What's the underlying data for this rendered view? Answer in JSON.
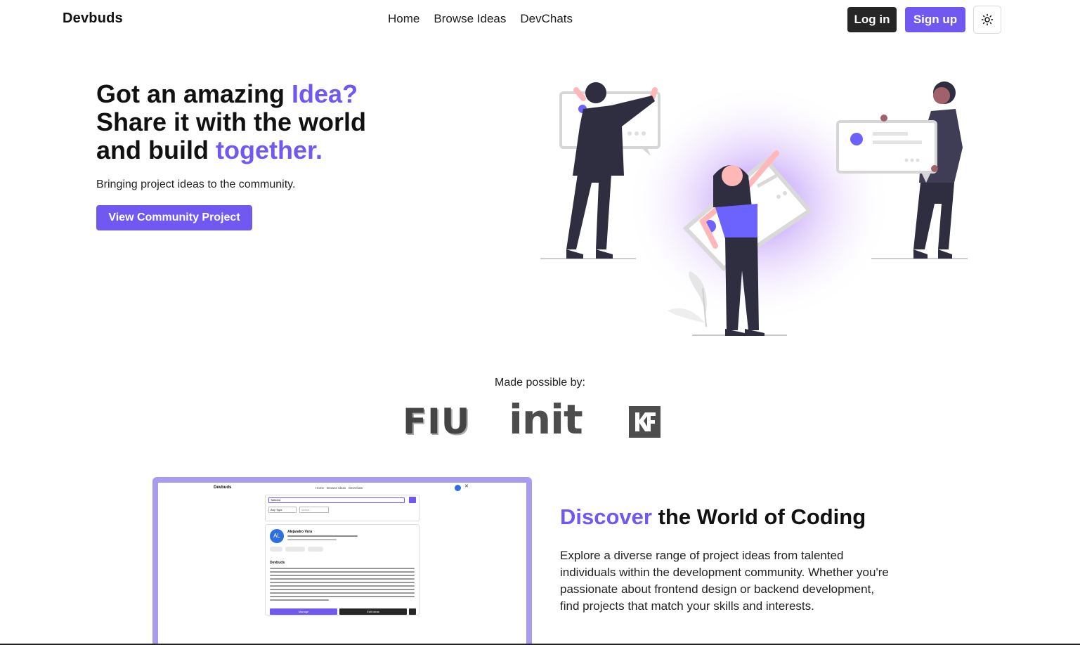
{
  "nav": {
    "brand": "Devbuds",
    "links": [
      "Home",
      "Browse Ideas",
      "DevChats"
    ],
    "login_label": "Log in",
    "signup_label": "Sign up",
    "theme_icon": "sun-icon"
  },
  "hero": {
    "line1_pre": "Got an amazing ",
    "line1_accent": "Idea?",
    "line2": "Share it with the world",
    "line3_pre": "and build ",
    "line3_accent": "together.",
    "subtitle": "Bringing project ideas to the community.",
    "cta_label": "View Community Project"
  },
  "sponsors": {
    "heading": "Made possible by:",
    "logos": [
      "FIU",
      "init",
      "KF"
    ]
  },
  "feature": {
    "title_accent": "Discover",
    "title_rest": " the World of Coding",
    "body": "Explore a diverse range of project ideas from talented individuals within the development community. Whether you're passionate about frontend design or backend development, find projects that match your skills and interests."
  },
  "preview": {
    "brand": "Devbuds",
    "links": [
      "Home",
      "Browse Ideas",
      "DevChats"
    ],
    "search_value": "Tailwind",
    "filter1": "Any Type",
    "filter2": "Select...",
    "avatar_initials": "AL",
    "user_name": "Alejandro Vera",
    "project_title": "Devbuds",
    "manage_label": "Manage",
    "edit_label": "Edit Ideas"
  },
  "colors": {
    "accent": "#7158f0",
    "dark_button": "#262626",
    "preview_frame": "#a99bf2"
  }
}
